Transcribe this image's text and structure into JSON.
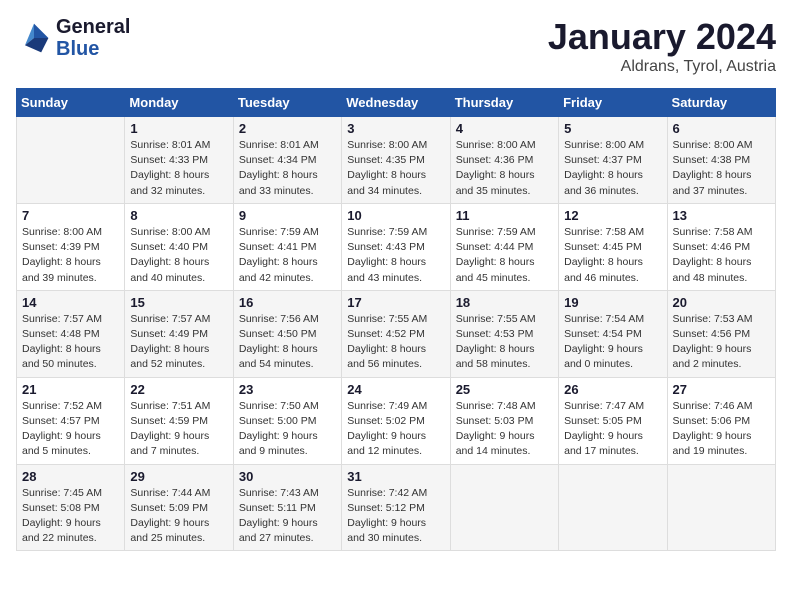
{
  "logo": {
    "line1": "General",
    "line2": "Blue"
  },
  "title": "January 2024",
  "subtitle": "Aldrans, Tyrol, Austria",
  "weekdays": [
    "Sunday",
    "Monday",
    "Tuesday",
    "Wednesday",
    "Thursday",
    "Friday",
    "Saturday"
  ],
  "weeks": [
    [
      {
        "day": "",
        "info": ""
      },
      {
        "day": "1",
        "info": "Sunrise: 8:01 AM\nSunset: 4:33 PM\nDaylight: 8 hours\nand 32 minutes."
      },
      {
        "day": "2",
        "info": "Sunrise: 8:01 AM\nSunset: 4:34 PM\nDaylight: 8 hours\nand 33 minutes."
      },
      {
        "day": "3",
        "info": "Sunrise: 8:00 AM\nSunset: 4:35 PM\nDaylight: 8 hours\nand 34 minutes."
      },
      {
        "day": "4",
        "info": "Sunrise: 8:00 AM\nSunset: 4:36 PM\nDaylight: 8 hours\nand 35 minutes."
      },
      {
        "day": "5",
        "info": "Sunrise: 8:00 AM\nSunset: 4:37 PM\nDaylight: 8 hours\nand 36 minutes."
      },
      {
        "day": "6",
        "info": "Sunrise: 8:00 AM\nSunset: 4:38 PM\nDaylight: 8 hours\nand 37 minutes."
      }
    ],
    [
      {
        "day": "7",
        "info": "Sunrise: 8:00 AM\nSunset: 4:39 PM\nDaylight: 8 hours\nand 39 minutes."
      },
      {
        "day": "8",
        "info": "Sunrise: 8:00 AM\nSunset: 4:40 PM\nDaylight: 8 hours\nand 40 minutes."
      },
      {
        "day": "9",
        "info": "Sunrise: 7:59 AM\nSunset: 4:41 PM\nDaylight: 8 hours\nand 42 minutes."
      },
      {
        "day": "10",
        "info": "Sunrise: 7:59 AM\nSunset: 4:43 PM\nDaylight: 8 hours\nand 43 minutes."
      },
      {
        "day": "11",
        "info": "Sunrise: 7:59 AM\nSunset: 4:44 PM\nDaylight: 8 hours\nand 45 minutes."
      },
      {
        "day": "12",
        "info": "Sunrise: 7:58 AM\nSunset: 4:45 PM\nDaylight: 8 hours\nand 46 minutes."
      },
      {
        "day": "13",
        "info": "Sunrise: 7:58 AM\nSunset: 4:46 PM\nDaylight: 8 hours\nand 48 minutes."
      }
    ],
    [
      {
        "day": "14",
        "info": "Sunrise: 7:57 AM\nSunset: 4:48 PM\nDaylight: 8 hours\nand 50 minutes."
      },
      {
        "day": "15",
        "info": "Sunrise: 7:57 AM\nSunset: 4:49 PM\nDaylight: 8 hours\nand 52 minutes."
      },
      {
        "day": "16",
        "info": "Sunrise: 7:56 AM\nSunset: 4:50 PM\nDaylight: 8 hours\nand 54 minutes."
      },
      {
        "day": "17",
        "info": "Sunrise: 7:55 AM\nSunset: 4:52 PM\nDaylight: 8 hours\nand 56 minutes."
      },
      {
        "day": "18",
        "info": "Sunrise: 7:55 AM\nSunset: 4:53 PM\nDaylight: 8 hours\nand 58 minutes."
      },
      {
        "day": "19",
        "info": "Sunrise: 7:54 AM\nSunset: 4:54 PM\nDaylight: 9 hours\nand 0 minutes."
      },
      {
        "day": "20",
        "info": "Sunrise: 7:53 AM\nSunset: 4:56 PM\nDaylight: 9 hours\nand 2 minutes."
      }
    ],
    [
      {
        "day": "21",
        "info": "Sunrise: 7:52 AM\nSunset: 4:57 PM\nDaylight: 9 hours\nand 5 minutes."
      },
      {
        "day": "22",
        "info": "Sunrise: 7:51 AM\nSunset: 4:59 PM\nDaylight: 9 hours\nand 7 minutes."
      },
      {
        "day": "23",
        "info": "Sunrise: 7:50 AM\nSunset: 5:00 PM\nDaylight: 9 hours\nand 9 minutes."
      },
      {
        "day": "24",
        "info": "Sunrise: 7:49 AM\nSunset: 5:02 PM\nDaylight: 9 hours\nand 12 minutes."
      },
      {
        "day": "25",
        "info": "Sunrise: 7:48 AM\nSunset: 5:03 PM\nDaylight: 9 hours\nand 14 minutes."
      },
      {
        "day": "26",
        "info": "Sunrise: 7:47 AM\nSunset: 5:05 PM\nDaylight: 9 hours\nand 17 minutes."
      },
      {
        "day": "27",
        "info": "Sunrise: 7:46 AM\nSunset: 5:06 PM\nDaylight: 9 hours\nand 19 minutes."
      }
    ],
    [
      {
        "day": "28",
        "info": "Sunrise: 7:45 AM\nSunset: 5:08 PM\nDaylight: 9 hours\nand 22 minutes."
      },
      {
        "day": "29",
        "info": "Sunrise: 7:44 AM\nSunset: 5:09 PM\nDaylight: 9 hours\nand 25 minutes."
      },
      {
        "day": "30",
        "info": "Sunrise: 7:43 AM\nSunset: 5:11 PM\nDaylight: 9 hours\nand 27 minutes."
      },
      {
        "day": "31",
        "info": "Sunrise: 7:42 AM\nSunset: 5:12 PM\nDaylight: 9 hours\nand 30 minutes."
      },
      {
        "day": "",
        "info": ""
      },
      {
        "day": "",
        "info": ""
      },
      {
        "day": "",
        "info": ""
      }
    ]
  ]
}
